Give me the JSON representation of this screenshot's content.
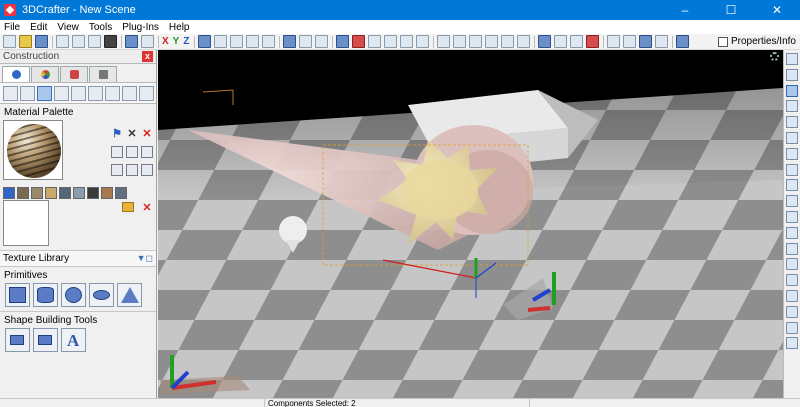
{
  "window": {
    "title": "3DCrafter - New Scene",
    "minimize": "–",
    "maximize": "☐",
    "close": "✕"
  },
  "menu": [
    "File",
    "Edit",
    "View",
    "Tools",
    "Plug-Ins",
    "Help"
  ],
  "toolbar": {
    "axes": [
      {
        "label": "X",
        "color": "#cc2222"
      },
      {
        "label": "Y",
        "color": "#229922"
      },
      {
        "label": "Z",
        "color": "#2255cc"
      }
    ],
    "properties_label": "Properties/Info"
  },
  "panel": {
    "title": "Construction",
    "close": "x",
    "tabs": [
      "construction-tab",
      "paint-tab",
      "effects-tab",
      "tools-tab"
    ],
    "material_palette": "Material Palette",
    "texture_library": "Texture Library",
    "primitives": "Primitives",
    "primitive_items": [
      "cube",
      "cylinder",
      "sphere",
      "torus",
      "cone"
    ],
    "shape_building_tools": "Shape Building Tools",
    "shape_tools": [
      "extrude",
      "lathe",
      "text"
    ],
    "text_tool_glyph": "A",
    "swatch_colors": [
      "#2f66c8",
      "#7a6a52",
      "#9a8a6a",
      "#caa86a",
      "#556677",
      "#8a9cb0",
      "#3a3a3a",
      "#a87850",
      "#607080"
    ]
  },
  "status": {
    "components_selected": "Components Selected: 2"
  },
  "colors": {
    "titlebar": "#0078d7",
    "viewport_bg": "#000000",
    "floor_light": "#c6c6c6",
    "floor_dark": "#8e8e8e"
  }
}
